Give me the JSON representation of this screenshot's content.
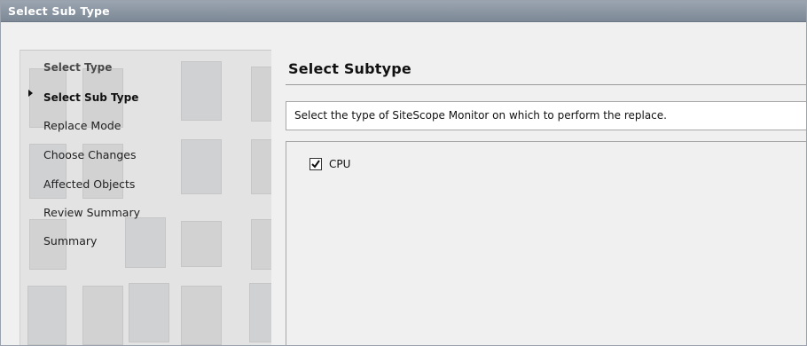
{
  "window": {
    "title": "Select Sub Type"
  },
  "wizard": {
    "steps": [
      {
        "label": "Select Type",
        "state": "done"
      },
      {
        "label": "Select Sub Type",
        "state": "current"
      },
      {
        "label": "Replace Mode",
        "state": "pending"
      },
      {
        "label": "Choose Changes",
        "state": "pending"
      },
      {
        "label": "Affected Objects",
        "state": "pending"
      },
      {
        "label": "Review Summary",
        "state": "pending"
      },
      {
        "label": "Summary",
        "state": "pending"
      }
    ]
  },
  "content": {
    "title": "Select Subtype",
    "description": "Select the type of SiteScope Monitor on which to perform the replace.",
    "options": [
      {
        "label": "CPU",
        "checked": true
      }
    ]
  },
  "icons": {
    "current_step": "triangle-right-icon",
    "checkbox": "checkmark-icon"
  },
  "colors": {
    "titlebar": "#8a95a2",
    "sidebar": "#e3e3e3",
    "panel": "#f0f0f0"
  }
}
